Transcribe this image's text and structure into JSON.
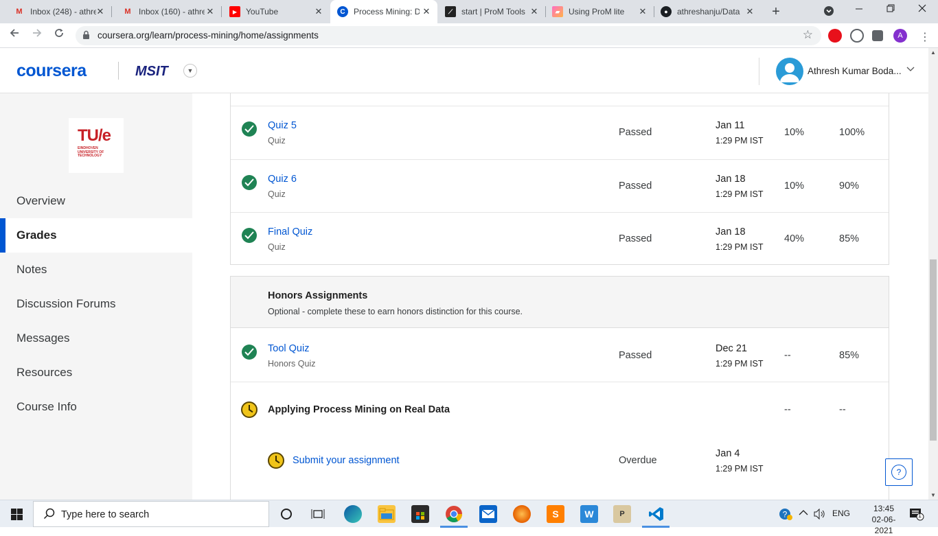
{
  "browser": {
    "tabs": [
      {
        "title": "Inbox (248) - athre",
        "icon": "gmail-icon",
        "active": false
      },
      {
        "title": "Inbox (160) - athre",
        "icon": "gmail-icon",
        "active": false
      },
      {
        "title": "YouTube",
        "icon": "youtube-icon",
        "active": false
      },
      {
        "title": "Process Mining: D",
        "icon": "coursera-icon",
        "active": true
      },
      {
        "title": "start | ProM Tools",
        "icon": "prom-icon",
        "active": false
      },
      {
        "title": "Using ProM lite",
        "icon": "ppt-icon",
        "active": false
      },
      {
        "title": "athreshanju/Data",
        "icon": "github-icon",
        "active": false
      }
    ],
    "close_glyph": "✕",
    "new_tab_glyph": "+",
    "url": "coursera.org/learn/process-mining/home/assignments",
    "profile_initial": "A"
  },
  "header": {
    "logo_text": "coursera",
    "partner_text": "MSIT",
    "username": "Athresh Kumar Boda..."
  },
  "sidebar": {
    "university": {
      "name": "TU/e",
      "sub": "EINDHOVEN UNIVERSITY OF TECHNOLOGY"
    },
    "items": [
      {
        "label": "Overview",
        "active": false
      },
      {
        "label": "Grades",
        "active": true
      },
      {
        "label": "Notes",
        "active": false
      },
      {
        "label": "Discussion Forums",
        "active": false
      },
      {
        "label": "Messages",
        "active": false
      },
      {
        "label": "Resources",
        "active": false
      },
      {
        "label": "Course Info",
        "active": false
      }
    ]
  },
  "grades": {
    "rows": [
      {
        "title": "Quiz 5",
        "type": "Quiz",
        "status": "Passed",
        "due_date": "Jan 11",
        "due_time": "1:29 PM IST",
        "weight": "10%",
        "grade": "100%"
      },
      {
        "title": "Quiz 6",
        "type": "Quiz",
        "status": "Passed",
        "due_date": "Jan 18",
        "due_time": "1:29 PM IST",
        "weight": "10%",
        "grade": "90%"
      },
      {
        "title": "Final Quiz",
        "type": "Quiz",
        "status": "Passed",
        "due_date": "Jan 18",
        "due_time": "1:29 PM IST",
        "weight": "40%",
        "grade": "85%"
      }
    ],
    "honors": {
      "title": "Honors Assignments",
      "subtitle": "Optional - complete these to earn honors distinction for this course.",
      "rows": [
        {
          "title": "Tool Quiz",
          "type": "Honors Quiz",
          "status": "Passed",
          "due_date": "Dec 21",
          "due_time": "1:29 PM IST",
          "weight": "--",
          "grade": "85%"
        }
      ],
      "section": {
        "title": "Applying Process Mining on Real Data",
        "weight": "--",
        "grade": "--"
      },
      "submit": {
        "label": "Submit your assignment",
        "status": "Overdue",
        "due_date": "Jan 4",
        "due_time": "1:29 PM IST"
      }
    }
  },
  "help": {
    "label": "?"
  },
  "taskbar": {
    "search_placeholder": "Type here to search",
    "language": "ENG",
    "time": "13:45",
    "date": "02-06-2021",
    "notification_count": "1"
  },
  "colors": {
    "brand": "#0056d2",
    "success": "#1f8354",
    "warning": "#f0c419"
  }
}
